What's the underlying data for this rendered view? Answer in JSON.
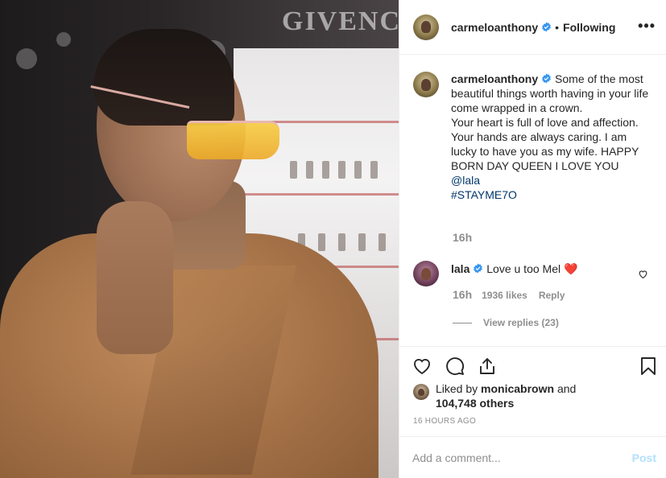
{
  "photo": {
    "store_sign": "GIVENCHY"
  },
  "header": {
    "username": "carmeloanthony",
    "separator": "•",
    "follow_status": "Following",
    "more_label": "•••"
  },
  "caption": {
    "username": "carmeloanthony",
    "text_lines": [
      "Some of the most beautiful things worth having in your life come wrapped in a crown.",
      "Your heart is full of love and affection. Your hands are always caring. I am lucky to have you as my wife. HAPPY BORN DAY QUEEN I LOVE YOU "
    ],
    "mention": "@lala",
    "hashtag": "#STAYME7O",
    "time": "16h"
  },
  "comment": {
    "username": "lala",
    "text": "Love u too Mel",
    "emoji": "❤️",
    "time": "16h",
    "likes": "1936 likes",
    "reply_label": "Reply",
    "view_replies": "View replies (23)"
  },
  "likes_summary": {
    "prefix": "Liked by ",
    "user": "monicabrown",
    "middle": " and",
    "count": "104,748 others"
  },
  "timestamp": "16 HOURS AGO",
  "add_comment": {
    "placeholder": "Add a comment...",
    "post_label": "Post"
  },
  "colors": {
    "verified": "#3897f0",
    "link": "#00376b",
    "post_disabled": "#b2dffc",
    "secondary_text": "#8e8e8e"
  },
  "icons": [
    "verified-badge-icon",
    "more-options-icon",
    "heart-icon",
    "comment-icon",
    "share-icon",
    "bookmark-icon",
    "comment-like-heart-icon"
  ]
}
